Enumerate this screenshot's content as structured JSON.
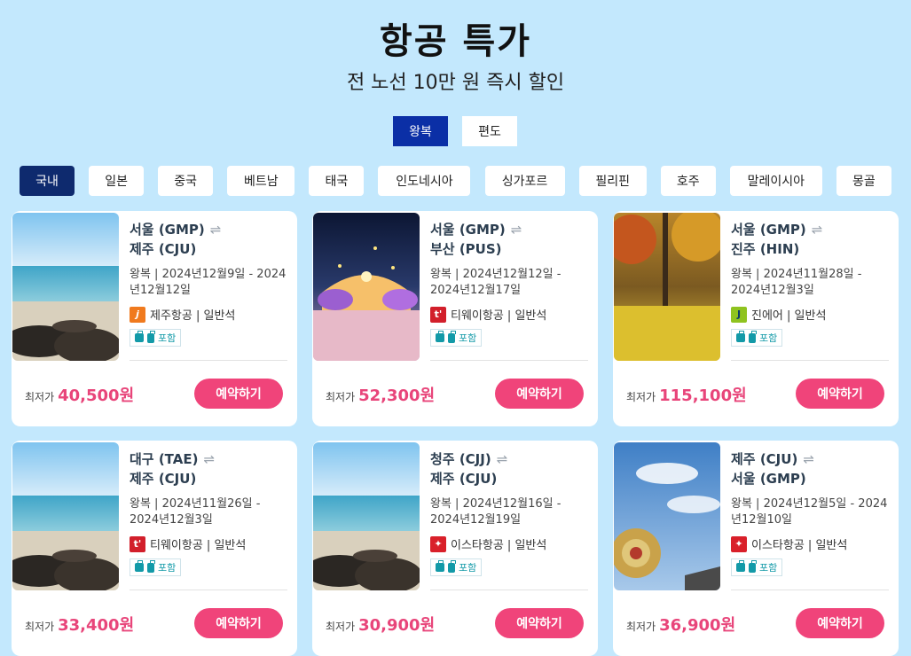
{
  "title": "항공 특가",
  "subtitle": "전 노선 10만 원 즉시 할인",
  "trip_types": [
    "왕복",
    "편도"
  ],
  "regions": [
    "국내",
    "일본",
    "중국",
    "베트남",
    "태국",
    "인도네시아",
    "싱가포르",
    "필리핀",
    "호주",
    "말레이시아",
    "몽골"
  ],
  "colors": {
    "background": "#c3e8fd",
    "accent": "#0b2fa6",
    "price": "#e8457a",
    "button": "#f0447a"
  },
  "cards": [
    {
      "origin": "서울 (GMP)",
      "dest": "제주 (CJU)",
      "dates": "왕복 | 2024년12월9일 - 2024년12월12일",
      "airline": "제주항공 | 일반석",
      "logo": "j",
      "baggage": "포함",
      "price_label": "최저가",
      "price": "40,500원",
      "button": "예약하기",
      "image": "beach-rocks"
    },
    {
      "origin": "서울 (GMP)",
      "dest": "부산 (PUS)",
      "dates": "왕복 | 2024년12월12일 - 2024년12월17일",
      "airline": "티웨이항공 | 일반석",
      "logo": "t'",
      "baggage": "포함",
      "price_label": "최저가",
      "price": "52,300원",
      "button": "예약하기",
      "image": "night-lights"
    },
    {
      "origin": "서울 (GMP)",
      "dest": "진주 (HIN)",
      "dates": "왕복 | 2024년11월28일 - 2024년12월3일",
      "airline": "진에어 | 일반석",
      "logo": "J",
      "baggage": "포함",
      "price_label": "최저가",
      "price": "115,100원",
      "button": "예약하기",
      "image": "autumn-leaves"
    },
    {
      "origin": "대구 (TAE)",
      "dest": "제주 (CJU)",
      "dates": "왕복 | 2024년11월26일 - 2024년12월3일",
      "airline": "티웨이항공 | 일반석",
      "logo": "t'",
      "baggage": "포함",
      "price_label": "최저가",
      "price": "33,400원",
      "button": "예약하기",
      "image": "beach-rocks"
    },
    {
      "origin": "청주 (CJJ)",
      "dest": "제주 (CJU)",
      "dates": "왕복 | 2024년12월16일 - 2024년12월19일",
      "airline": "이스타항공 | 일반석",
      "logo": "✦",
      "baggage": "포함",
      "price_label": "최저가",
      "price": "30,900원",
      "button": "예약하기",
      "image": "beach-rocks"
    },
    {
      "origin": "제주 (CJU)",
      "dest": "서울 (GMP)",
      "dates": "왕복 | 2024년12월5일 - 2024년12월10일",
      "airline": "이스타항공 | 일반석",
      "logo": "✦",
      "baggage": "포함",
      "price_label": "최저가",
      "price": "36,900원",
      "button": "예약하기",
      "image": "sky-drum"
    }
  ]
}
